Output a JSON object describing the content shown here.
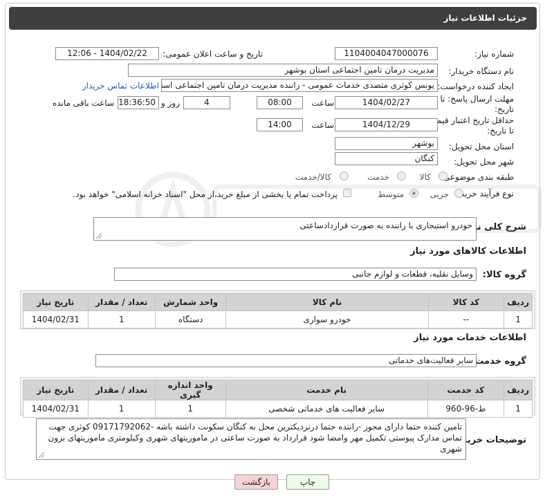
{
  "header": {
    "title": "جزئیات اطلاعات نیاز"
  },
  "form": {
    "need_number_label": "شماره نیاز:",
    "need_number": "1104004047000076",
    "announce_label": "تاریخ و ساعت اعلان عمومی:",
    "announce_value": "1404/02/22 - 12:06",
    "buyer_org_label": "نام دستگاه خریدار:",
    "buyer_org": "مدیریت درمان تامین اجتماعی استان بوشهر",
    "requester_label": "ایجاد کننده درخواست:",
    "requester": "یونس کوثری متصدی خدمات عمومی - راننده مدیریت درمان تامین اجتماعی استا",
    "contact_link": "اطلاعات تماس خریدار",
    "deadline_label_1": "مهلت ارسال پاسخ: تا",
    "deadline_label_2": "تاریخ:",
    "deadline_date": "1404/02/27",
    "time_label": "ساعت",
    "deadline_time": "08:00",
    "days_value": "4",
    "days_label": "روز و",
    "remaining_time": "18:36:50",
    "remaining_label": "ساعت باقی مانده",
    "validity_label_1": "حداقل تاریخ اعتبار قیمت:",
    "validity_label_2": "تا تاریخ:",
    "validity_date": "1404/12/29",
    "validity_time": "14:00",
    "province_label": "استان محل تحویل:",
    "province": "بوشهر",
    "city_label": "شهر محل تحویل:",
    "city": "کنگان",
    "category_label": "طبقه بندی موضوعی:",
    "category_options": [
      "کالا",
      "خدمت",
      "کالا/خدمت"
    ],
    "process_label": "نوع فرآیند خرید :",
    "process_options": [
      "جزیی",
      "متوسط"
    ],
    "payment_note": "پرداخت تمام یا بخشی از مبلغ خرید،از محل \"اسناد خزانه اسلامی\" خواهد بود."
  },
  "description": {
    "label": "شرح کلی نیاز:",
    "value": "خودرو استیجاری  با راننده به صورت قراردادساعتی"
  },
  "goods": {
    "section_title": "اطلاعات کالاهای مورد نیاز",
    "group_label": "گروه کالا:",
    "group_value": "وسایل نقلیه، قطعات و لوازم جانبی",
    "columns": [
      "ردیف",
      "کد کالا",
      "نام کالا",
      "واحد شمارش",
      "تعداد / مقدار",
      "تاریخ نیاز"
    ],
    "rows": [
      [
        "1",
        "--",
        "خودرو سواری",
        "دستگاه",
        "1",
        "1404/02/31"
      ]
    ]
  },
  "services": {
    "section_title": "اطلاعات خدمات مورد نیاز",
    "group_label": "گروه خدمت:",
    "group_value": "سایر فعالیت‌های خدماتی",
    "columns": [
      "ردیف",
      "کد خدمت",
      "نام خدمت",
      "واحد اندازه گیری",
      "تعداد / مقدار",
      "تاریخ نیاز"
    ],
    "rows": [
      [
        "1",
        "ط-96-960",
        "سایر فعالیت های خدماتی شخصی",
        "1",
        "1",
        "1404/02/31"
      ]
    ]
  },
  "buyer_notes": {
    "label": "توضیحات خریدار:",
    "value": "تامین کننده حتما دارای مجوز -راننده حتما درنزدیکترین محل به کنگان سکونت داشته باشه -09171792062 کوثری جهت تماس مدارک پیوستی تکمیل مهر وامضا شود قرارداد به صورت ساعتی در ماموریتهای شهری وکیلومتری ماموریتهای برون شهری"
  },
  "buttons": {
    "print": "چاپ",
    "back": "بازگشت"
  },
  "colors": {
    "title_bg": "#3f3f3f",
    "link": "#1d5fc4",
    "back_bg": "#f6d3d3",
    "print_bg": "#eefbe8"
  }
}
